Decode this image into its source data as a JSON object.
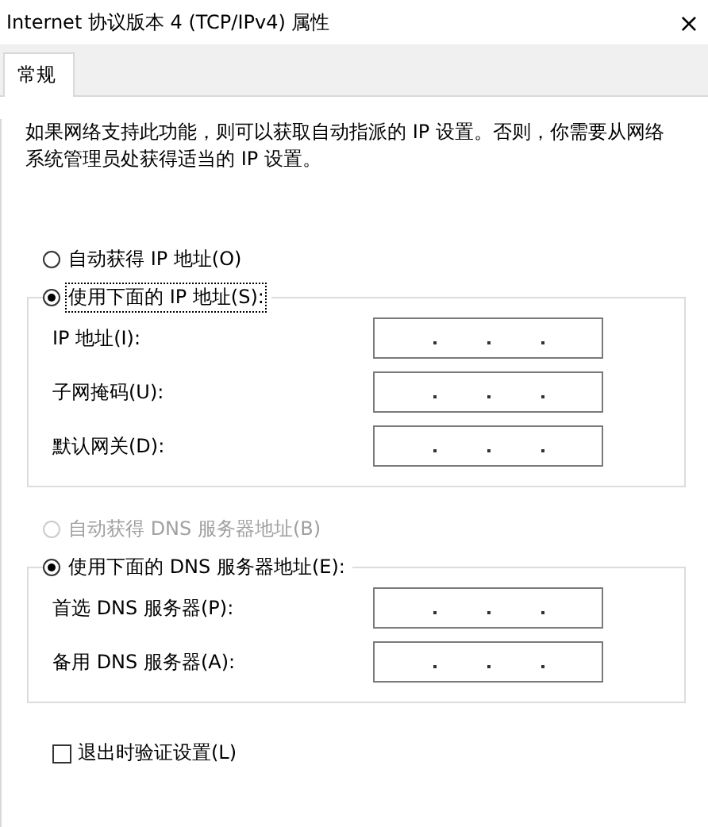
{
  "window": {
    "title": "Internet 协议版本 4 (TCP/IPv4) 属性",
    "close": "×"
  },
  "tabs": [
    {
      "label": "常规",
      "selected": true
    }
  ],
  "description": "如果网络支持此功能，则可以获取自动指派的 IP 设置。否则，你需要从网络系统管理员处获得适当的 IP 设置。",
  "ip_mode": {
    "auto": {
      "label": "自动获得 IP 地址(O)",
      "selected": false,
      "disabled": false
    },
    "manual": {
      "label": "使用下面的 IP 地址(S):",
      "selected": true,
      "disabled": false,
      "focused": true
    },
    "fields": [
      {
        "label": "IP 地址(I):"
      },
      {
        "label": "子网掩码(U):"
      },
      {
        "label": "默认网关(D):"
      }
    ]
  },
  "dns_mode": {
    "auto": {
      "label": "自动获得 DNS 服务器地址(B)",
      "selected": false,
      "disabled": true
    },
    "manual": {
      "label": "使用下面的 DNS 服务器地址(E):",
      "selected": true,
      "disabled": false,
      "focused": false
    },
    "fields": [
      {
        "label": "首选 DNS 服务器(P):"
      },
      {
        "label": "备用 DNS 服务器(A):"
      }
    ]
  },
  "validate_on_exit": {
    "label": "退出时验证设置(L)",
    "checked": false
  }
}
